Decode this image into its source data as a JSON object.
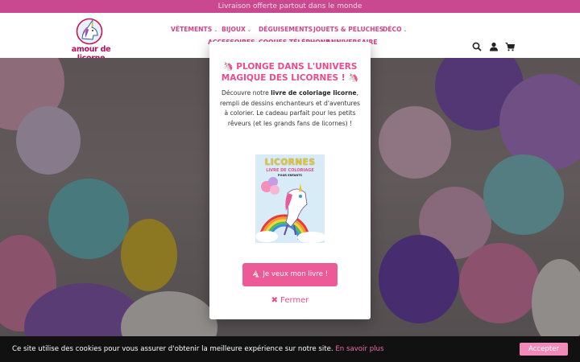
{
  "announcement": "Livraison offerte partout dans le monde",
  "brand": {
    "name": "amour de licorne"
  },
  "nav": [
    {
      "label": "VÊTEMENTS",
      "dropdown": true
    },
    {
      "label": "BIJOUX",
      "dropdown": true
    },
    {
      "label": "DÉGUISEMENTS",
      "dropdown": false
    },
    {
      "label": "JOUETS & PELUCHES",
      "dropdown": false
    },
    {
      "label": "DÉCO",
      "dropdown": true
    },
    {
      "label": "ACCESSOIRES",
      "dropdown": false
    },
    {
      "label": "COQUES TÉLÉPHONE",
      "dropdown": false
    },
    {
      "label": "ANNIVERSAIRE",
      "dropdown": false
    }
  ],
  "header_icons": [
    "search-icon",
    "user-icon",
    "cart-icon"
  ],
  "modal": {
    "title": "🦄 PLONGE DANS L'UNIVERS MAGIQUE DES LICORNES ! 🦄",
    "body_prefix": "Découvre notre ",
    "body_bold1": "livre de coloriage licorne",
    "body_suffix": ", rempli de dessins enchanteurs et d'aventures à colorier. Le cadeau parfait pour les petits rêveurs (et les grands fans de licornes) !",
    "book": {
      "title": "LICORNES",
      "subtitle": "LIVRE DE COLORIAGE",
      "subtitle2": "POUR ENFANTS"
    },
    "cta_label": "🦄 Je veux mon livre !",
    "close_label": "✖ Fermer"
  },
  "cookie": {
    "text": "Ce site utilise des cookies pour vous assurer d'obtenir la meilleure expérience sur notre site.",
    "link": "En savoir plus",
    "accept": "Accepter"
  },
  "colors": {
    "announce_bg": "#c9488f",
    "brand_pink": "#e74c8c",
    "cta_bg": "#ee5a97",
    "cookie_bg": "#111111",
    "accept_bg": "#f28ab9"
  }
}
